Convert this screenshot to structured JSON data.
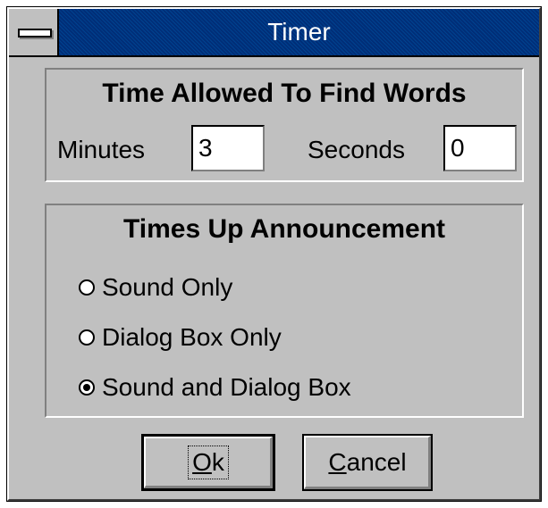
{
  "window": {
    "title": "Timer"
  },
  "time_group": {
    "heading": "Time Allowed To Find Words",
    "minutes_label": "Minutes",
    "minutes_value": "3",
    "seconds_label": "Seconds",
    "seconds_value": "0"
  },
  "announce_group": {
    "heading": "Times Up Announcement",
    "options": [
      {
        "label": "Sound Only",
        "selected": false
      },
      {
        "label": "Dialog Box Only",
        "selected": false
      },
      {
        "label": "Sound and Dialog Box",
        "selected": true
      }
    ]
  },
  "buttons": {
    "ok_mnemonic": "O",
    "ok_rest": "k",
    "cancel_mnemonic": "C",
    "cancel_rest": "ancel"
  },
  "colors": {
    "titlebar": "#003d8a",
    "face": "#c0c0c0"
  }
}
